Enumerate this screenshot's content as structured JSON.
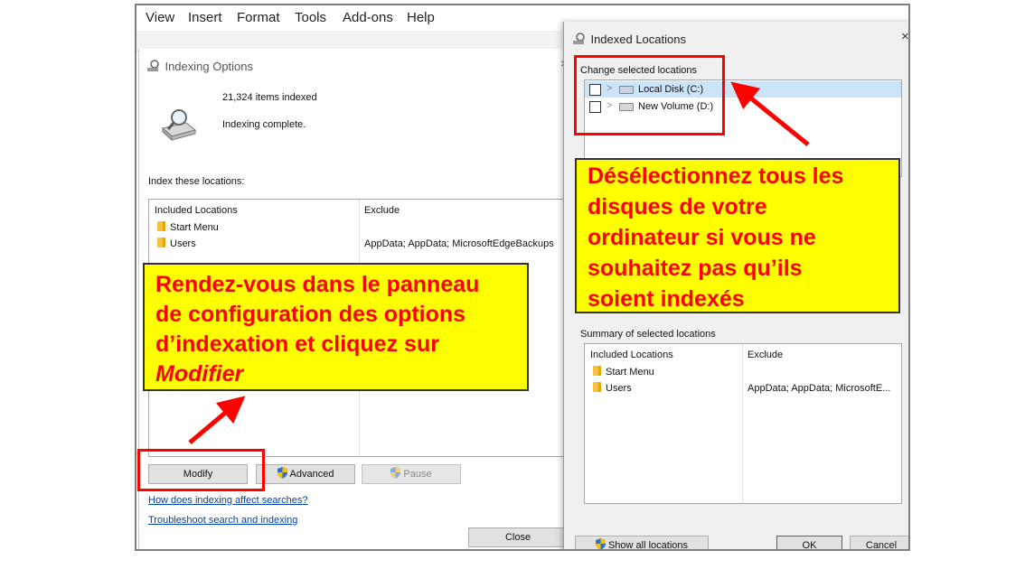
{
  "menubar": {
    "items": [
      "View",
      "Insert",
      "Format",
      "Tools",
      "Add-ons",
      "Help"
    ]
  },
  "indexing_options": {
    "title": "Indexing Options",
    "items_indexed": "21,324 items indexed",
    "status": "Indexing complete.",
    "section_label": "Index these locations:",
    "columns": {
      "included": "Included Locations",
      "exclude": "Exclude"
    },
    "rows": [
      {
        "included": "Start Menu",
        "exclude": ""
      },
      {
        "included": "Users",
        "exclude": "AppData; AppData; MicrosoftEdgeBackups"
      }
    ],
    "buttons": {
      "modify": "Modify",
      "advanced": "Advanced",
      "pause": "Pause",
      "close": "Close"
    },
    "links": {
      "how": "How does indexing affect searches?",
      "troubleshoot": "Troubleshoot search and indexing"
    }
  },
  "indexed_locations": {
    "title": "Indexed Locations",
    "change_label": "Change selected locations",
    "drives": [
      {
        "label": "Local Disk (C:)",
        "checked": false
      },
      {
        "label": "New Volume (D:)",
        "checked": false
      }
    ],
    "summary_label": "Summary of selected locations",
    "columns": {
      "included": "Included Locations",
      "exclude": "Exclude"
    },
    "rows": [
      {
        "included": "Start Menu",
        "exclude": ""
      },
      {
        "included": "Users",
        "exclude": "AppData; AppData; MicrosoftE..."
      }
    ],
    "buttons": {
      "show_all": "Show all locations",
      "ok": "OK",
      "cancel": "Cancel"
    }
  },
  "annotations": {
    "left": {
      "line1": "Rendez-vous dans le panneau",
      "line2": "de configuration des options",
      "line3": "d’indexation et cliquez sur",
      "line4": "Modifier"
    },
    "right": {
      "line1": "Désélectionnez tous les",
      "line2": "disques de votre",
      "line3": "ordinateur si vous ne",
      "line4": "souhaitez pas qu’ils",
      "line5": "soient indexés"
    },
    "accent": "#ff0000",
    "callout_bg": "#ffff00"
  }
}
